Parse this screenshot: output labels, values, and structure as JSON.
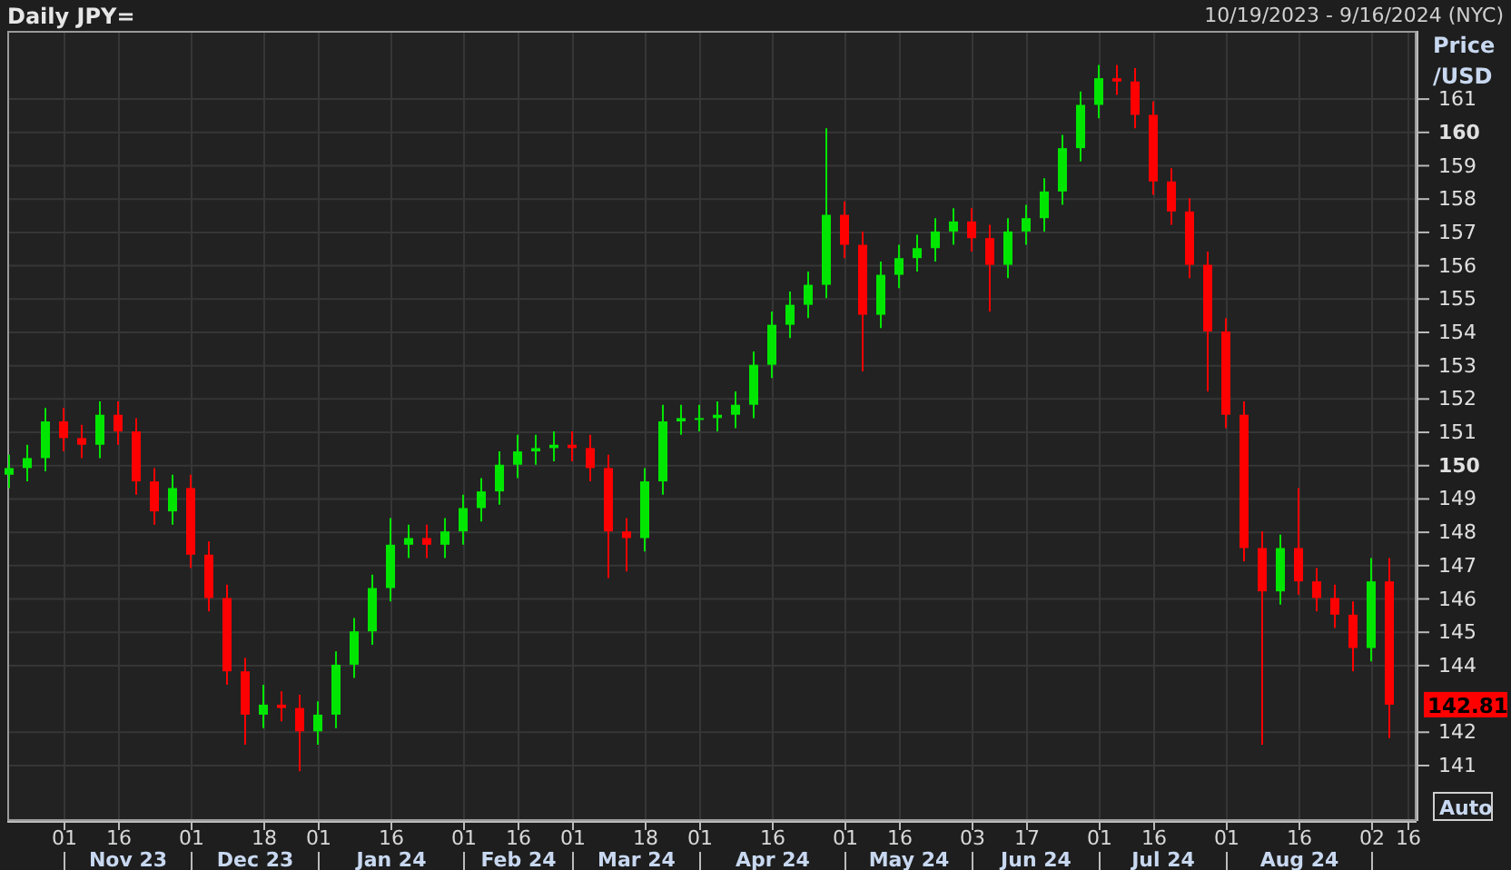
{
  "header": {
    "title": "Daily JPY=",
    "range": "10/19/2023 - 9/16/2024 (NYC)"
  },
  "chart": {
    "last_price": "142.81",
    "auto_button": "Auto",
    "months": [
      {
        "label": "Nov 23"
      },
      {
        "label": "Dec 23"
      },
      {
        "label": "Jan 24"
      },
      {
        "label": "Feb 24"
      },
      {
        "label": "Mar 24"
      },
      {
        "label": "Apr 24"
      },
      {
        "label": "May 24"
      },
      {
        "label": "Jun 24"
      },
      {
        "label": "Jul 24"
      },
      {
        "label": "Aug 24"
      }
    ],
    "chart_data": {
      "type": "candlestick",
      "ylabel": "Price /USD",
      "grid": true,
      "ylim": [
        139.31,
        163.02
      ],
      "yticks": [
        {
          "value": 161,
          "label": "161"
        },
        {
          "value": 160,
          "label": "160"
        },
        {
          "value": 159,
          "label": "159"
        },
        {
          "value": 158,
          "label": "158"
        },
        {
          "value": 157,
          "label": "157"
        },
        {
          "value": 156,
          "label": "156"
        },
        {
          "value": 155,
          "label": "155"
        },
        {
          "value": 154,
          "label": "154"
        },
        {
          "value": 153,
          "label": "153"
        },
        {
          "value": 152,
          "label": "152"
        },
        {
          "value": 151,
          "label": "151"
        },
        {
          "value": 150,
          "label": "150"
        },
        {
          "value": 149,
          "label": "149"
        },
        {
          "value": 148,
          "label": "148"
        },
        {
          "value": 147,
          "label": "147"
        },
        {
          "value": 146,
          "label": "146"
        },
        {
          "value": 145,
          "label": "145"
        },
        {
          "value": 144,
          "label": "144"
        },
        {
          "value": 142,
          "label": "142"
        },
        {
          "value": 141,
          "label": "141"
        }
      ],
      "categories": [
        null,
        null,
        null,
        "01",
        null,
        null,
        "16",
        null,
        null,
        null,
        "01",
        null,
        null,
        null,
        "18",
        null,
        null,
        "01",
        null,
        null,
        null,
        "16",
        null,
        null,
        null,
        "01",
        null,
        null,
        "16",
        null,
        null,
        "01",
        null,
        null,
        null,
        "18",
        null,
        null,
        "01",
        null,
        null,
        null,
        "16",
        null,
        null,
        null,
        "01",
        null,
        null,
        "16",
        null,
        null,
        null,
        "03",
        null,
        null,
        "17",
        null,
        null,
        null,
        "01",
        null,
        null,
        "16",
        null,
        null,
        null,
        "01",
        null,
        null,
        null,
        "16",
        null,
        null,
        null,
        "02",
        null,
        "16"
      ],
      "ohlc": [
        [
          149.7,
          150.3,
          149.3,
          149.9
        ],
        [
          149.9,
          150.6,
          149.5,
          150.2
        ],
        [
          150.2,
          151.7,
          149.8,
          151.3
        ],
        [
          151.3,
          151.7,
          150.4,
          150.8
        ],
        [
          150.8,
          151.2,
          150.2,
          150.6
        ],
        [
          150.6,
          151.9,
          150.2,
          151.5
        ],
        [
          151.5,
          151.9,
          150.6,
          151.0
        ],
        [
          151.0,
          151.4,
          149.1,
          149.5
        ],
        [
          149.5,
          149.9,
          148.2,
          148.6
        ],
        [
          148.6,
          149.7,
          148.2,
          149.3
        ],
        [
          149.3,
          149.7,
          146.9,
          147.3
        ],
        [
          147.3,
          147.7,
          145.6,
          146.0
        ],
        [
          146.0,
          146.4,
          143.4,
          143.8
        ],
        [
          143.8,
          144.2,
          141.6,
          142.5
        ],
        [
          142.5,
          143.4,
          142.1,
          142.8
        ],
        [
          142.8,
          143.2,
          142.3,
          142.7
        ],
        [
          142.7,
          143.1,
          140.8,
          142.0
        ],
        [
          142.0,
          142.9,
          141.6,
          142.5
        ],
        [
          142.5,
          144.4,
          142.1,
          144.0
        ],
        [
          144.0,
          145.4,
          143.6,
          145.0
        ],
        [
          145.0,
          146.7,
          144.6,
          146.3
        ],
        [
          146.3,
          148.4,
          145.9,
          147.6
        ],
        [
          147.6,
          148.2,
          147.2,
          147.8
        ],
        [
          147.8,
          148.2,
          147.2,
          147.6
        ],
        [
          147.6,
          148.4,
          147.2,
          148.0
        ],
        [
          148.0,
          149.1,
          147.6,
          148.7
        ],
        [
          148.7,
          149.6,
          148.3,
          149.2
        ],
        [
          149.2,
          150.4,
          148.8,
          150.0
        ],
        [
          150.0,
          150.9,
          149.6,
          150.4
        ],
        [
          150.4,
          150.9,
          150.0,
          150.5
        ],
        [
          150.5,
          151.0,
          150.1,
          150.6
        ],
        [
          150.6,
          151.0,
          150.1,
          150.5
        ],
        [
          150.5,
          150.9,
          149.5,
          149.9
        ],
        [
          149.9,
          150.3,
          146.6,
          148.0
        ],
        [
          148.0,
          148.4,
          146.8,
          147.8
        ],
        [
          147.8,
          149.9,
          147.4,
          149.5
        ],
        [
          149.5,
          151.8,
          149.1,
          151.3
        ],
        [
          151.3,
          151.8,
          150.9,
          151.4
        ],
        [
          151.4,
          151.8,
          151.0,
          151.4
        ],
        [
          151.4,
          151.9,
          151.0,
          151.5
        ],
        [
          151.5,
          152.2,
          151.1,
          151.8
        ],
        [
          151.8,
          153.4,
          151.4,
          153.0
        ],
        [
          153.0,
          154.6,
          152.6,
          154.2
        ],
        [
          154.2,
          155.2,
          153.8,
          154.8
        ],
        [
          154.8,
          155.8,
          154.4,
          155.4
        ],
        [
          155.4,
          160.1,
          155.0,
          157.5
        ],
        [
          157.5,
          157.9,
          156.2,
          156.6
        ],
        [
          156.6,
          157.0,
          152.8,
          154.5
        ],
        [
          154.5,
          156.1,
          154.1,
          155.7
        ],
        [
          155.7,
          156.6,
          155.3,
          156.2
        ],
        [
          156.2,
          156.9,
          155.8,
          156.5
        ],
        [
          156.5,
          157.4,
          156.1,
          157.0
        ],
        [
          157.0,
          157.7,
          156.6,
          157.3
        ],
        [
          157.3,
          157.7,
          156.4,
          156.8
        ],
        [
          156.8,
          157.2,
          154.6,
          156.0
        ],
        [
          156.0,
          157.4,
          155.6,
          157.0
        ],
        [
          157.0,
          157.8,
          156.6,
          157.4
        ],
        [
          157.4,
          158.6,
          157.0,
          158.2
        ],
        [
          158.2,
          159.9,
          157.8,
          159.5
        ],
        [
          159.5,
          161.2,
          159.1,
          160.8
        ],
        [
          160.8,
          162.0,
          160.4,
          161.6
        ],
        [
          161.6,
          162.0,
          161.1,
          161.5
        ],
        [
          161.5,
          161.9,
          160.1,
          160.5
        ],
        [
          160.5,
          160.9,
          158.1,
          158.5
        ],
        [
          158.5,
          158.9,
          157.2,
          157.6
        ],
        [
          157.6,
          158.0,
          155.6,
          156.0
        ],
        [
          156.0,
          156.4,
          152.2,
          154.0
        ],
        [
          154.0,
          154.4,
          151.1,
          151.5
        ],
        [
          151.5,
          151.9,
          147.1,
          147.5
        ],
        [
          147.5,
          148.0,
          141.6,
          146.2
        ],
        [
          146.2,
          147.9,
          145.8,
          147.5
        ],
        [
          147.5,
          149.3,
          146.1,
          146.5
        ],
        [
          146.5,
          146.9,
          145.6,
          146.0
        ],
        [
          146.0,
          146.4,
          145.1,
          145.5
        ],
        [
          145.5,
          145.9,
          143.8,
          144.5
        ],
        [
          144.5,
          147.2,
          144.1,
          146.5
        ],
        [
          146.5,
          147.2,
          141.8,
          142.8
        ],
        null
      ]
    }
  }
}
